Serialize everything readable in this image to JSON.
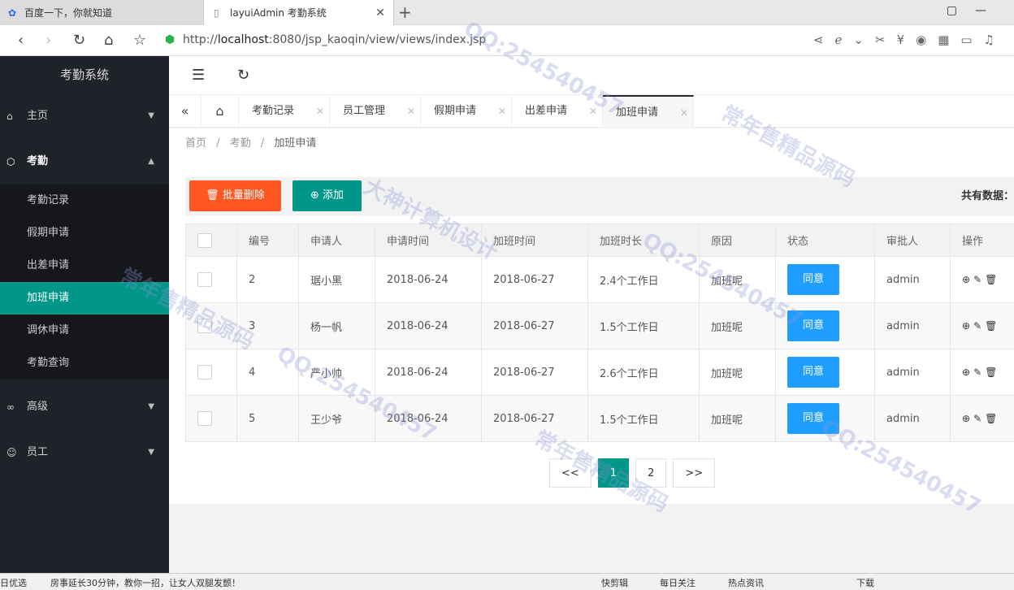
{
  "browser": {
    "tabs": [
      {
        "title": "百度一下，你就知道"
      },
      {
        "title": "layuiAdmin 考勤系统"
      }
    ],
    "url_prefix": "http://",
    "url_host": "localhost",
    "url_rest": ":8080/jsp_kaoqin/view/views/index.jsp"
  },
  "sidebar": {
    "title": "考勤系统",
    "menus": [
      {
        "label": "主页"
      },
      {
        "label": "考勤"
      },
      {
        "label": "高级"
      },
      {
        "label": "员工"
      }
    ],
    "sub_items": [
      {
        "label": "考勤记录"
      },
      {
        "label": "假期申请"
      },
      {
        "label": "出差申请"
      },
      {
        "label": "加班申请"
      },
      {
        "label": "调休申请"
      },
      {
        "label": "考勤查询"
      }
    ]
  },
  "page_tabs": [
    {
      "label": "考勤记录"
    },
    {
      "label": "员工管理"
    },
    {
      "label": "假期申请"
    },
    {
      "label": "出差申请"
    },
    {
      "label": "加班申请"
    }
  ],
  "breadcrumb": {
    "home": "首页",
    "section": "考勤",
    "current": "加班申请"
  },
  "toolbar": {
    "delete_label": "批量删除",
    "add_label": "添加",
    "total_label": "共有数据："
  },
  "table": {
    "headers": [
      "编号",
      "申请人",
      "申请时间",
      "加班时间",
      "加班时长",
      "原因",
      "状态",
      "审批人",
      "操作"
    ],
    "rows": [
      {
        "id": "2",
        "applicant": "琚小黑",
        "apply_date": "2018-06-24",
        "ot_date": "2018-06-27",
        "duration": "2.4个工作日",
        "reason": "加班呢",
        "status": "同意",
        "approver": "admin"
      },
      {
        "id": "3",
        "applicant": "杨一帆",
        "apply_date": "2018-06-24",
        "ot_date": "2018-06-27",
        "duration": "1.5个工作日",
        "reason": "加班呢",
        "status": "同意",
        "approver": "admin"
      },
      {
        "id": "4",
        "applicant": "严小帅",
        "apply_date": "2018-06-24",
        "ot_date": "2018-06-27",
        "duration": "2.6个工作日",
        "reason": "加班呢",
        "status": "同意",
        "approver": "admin"
      },
      {
        "id": "5",
        "applicant": "王少爷",
        "apply_date": "2018-06-24",
        "ot_date": "2018-06-27",
        "duration": "1.5个工作日",
        "reason": "加班呢",
        "status": "同意",
        "approver": "admin"
      }
    ]
  },
  "pager": {
    "prev": "<<",
    "pages": [
      "1",
      "2"
    ],
    "next": ">>"
  },
  "taskbar": {
    "left": "日优选",
    "news": "房事延长30分钟，教你一招，让女人双腿发颤！",
    "items": [
      "快剪辑",
      "每日关注",
      "热点资讯",
      "下载"
    ]
  },
  "colors": {
    "accent": "#009688",
    "danger": "#ff5722",
    "info": "#1e9fff",
    "sidebar": "#20222a"
  }
}
